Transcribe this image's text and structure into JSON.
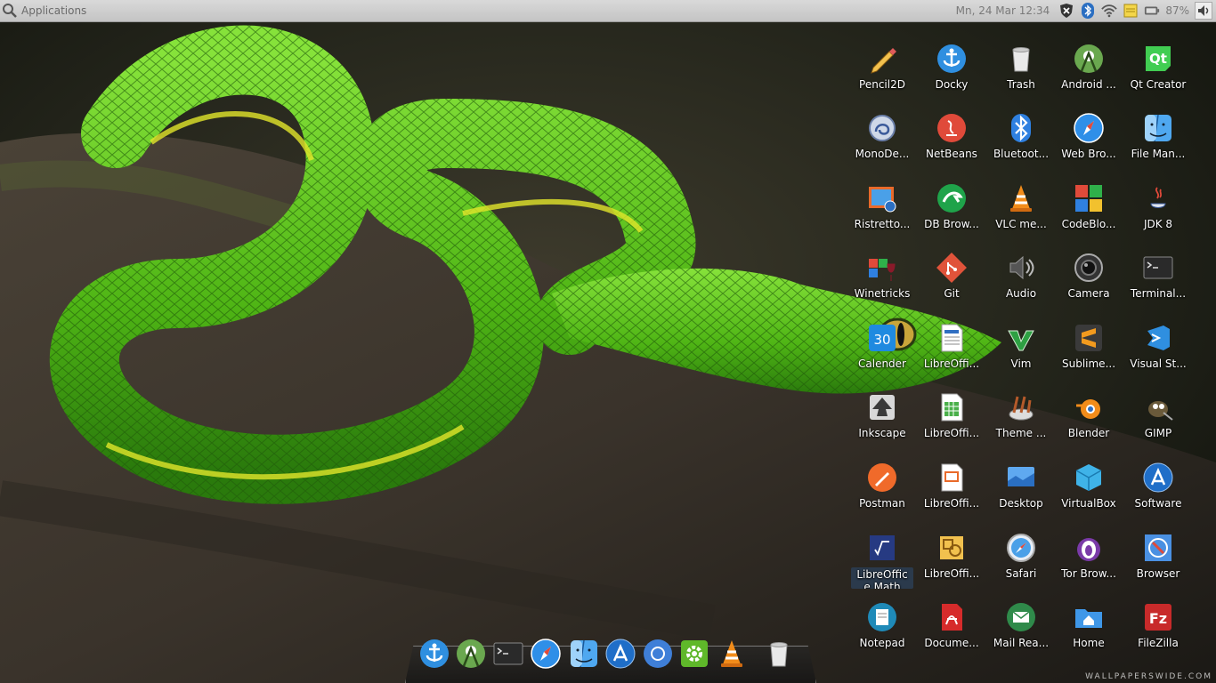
{
  "panel": {
    "apps_label": "Applications",
    "clock": "Mn, 24 Mar 12:34",
    "battery_pct": "87%"
  },
  "desktop": {
    "icons": [
      {
        "label": "Pencil2D",
        "icon": "pencil-icon"
      },
      {
        "label": "Docky",
        "icon": "anchor-icon"
      },
      {
        "label": "Trash",
        "icon": "trash-icon"
      },
      {
        "label": "Android ...",
        "icon": "android-studio-icon"
      },
      {
        "label": "Qt Creator",
        "icon": "qt-icon"
      },
      {
        "label": "MonoDe...",
        "icon": "monodevelop-icon"
      },
      {
        "label": "NetBeans",
        "icon": "netbeans-icon"
      },
      {
        "label": "Bluetoot...",
        "icon": "bluetooth-icon"
      },
      {
        "label": "Web Bro...",
        "icon": "compass-icon"
      },
      {
        "label": "File Man...",
        "icon": "finder-icon"
      },
      {
        "label": "Ristretto...",
        "icon": "image-viewer-icon"
      },
      {
        "label": "DB Brow...",
        "icon": "db-browser-icon"
      },
      {
        "label": "VLC me...",
        "icon": "vlc-cone-icon"
      },
      {
        "label": "CodeBlo...",
        "icon": "codeblocks-icon"
      },
      {
        "label": "JDK 8",
        "icon": "java-icon"
      },
      {
        "label": "Winetricks",
        "icon": "winetricks-icon"
      },
      {
        "label": "Git",
        "icon": "git-icon"
      },
      {
        "label": "Audio",
        "icon": "speaker-icon"
      },
      {
        "label": "Camera",
        "icon": "camera-icon"
      },
      {
        "label": "Terminal...",
        "icon": "terminal-icon"
      },
      {
        "label": "Calender",
        "icon": "calendar-icon",
        "badge": "30"
      },
      {
        "label": "LibreOffi...",
        "icon": "writer-doc-icon"
      },
      {
        "label": "Vim",
        "icon": "vim-icon"
      },
      {
        "label": "Sublime...",
        "icon": "sublime-icon"
      },
      {
        "label": "Visual St...",
        "icon": "vscode-icon"
      },
      {
        "label": "Inkscape",
        "icon": "inkscape-icon"
      },
      {
        "label": "LibreOffi...",
        "icon": "calc-sheet-icon"
      },
      {
        "label": "Theme ...",
        "icon": "theme-tools-icon"
      },
      {
        "label": "Blender",
        "icon": "blender-icon"
      },
      {
        "label": "GIMP",
        "icon": "gimp-icon"
      },
      {
        "label": "Postman",
        "icon": "postman-icon"
      },
      {
        "label": "LibreOffi...",
        "icon": "impress-icon"
      },
      {
        "label": "Desktop",
        "icon": "desktop-folder-icon"
      },
      {
        "label": "VirtualBox",
        "icon": "virtualbox-icon"
      },
      {
        "label": "Software",
        "icon": "app-store-icon"
      },
      {
        "label": "LibreOffic e Math",
        "icon": "math-formula-icon"
      },
      {
        "label": "LibreOffi...",
        "icon": "draw-icon"
      },
      {
        "label": "Safari",
        "icon": "safari-icon"
      },
      {
        "label": "Tor Brow...",
        "icon": "tor-onion-icon"
      },
      {
        "label": "Browser",
        "icon": "browser-globe-icon"
      },
      {
        "label": "Notepad",
        "icon": "notepad-icon"
      },
      {
        "label": "Docume...",
        "icon": "pdf-icon"
      },
      {
        "label": "Mail Rea...",
        "icon": "mail-icon"
      },
      {
        "label": "Home",
        "icon": "home-folder-icon"
      },
      {
        "label": "FileZilla",
        "icon": "filezilla-icon"
      }
    ]
  },
  "dock": {
    "items": [
      {
        "name": "docky",
        "icon": "anchor-icon"
      },
      {
        "name": "android-studio",
        "icon": "android-studio-icon"
      },
      {
        "name": "terminal",
        "icon": "terminal-icon"
      },
      {
        "name": "safari",
        "icon": "compass-icon"
      },
      {
        "name": "finder",
        "icon": "finder-icon"
      },
      {
        "name": "app-store",
        "icon": "app-store-icon"
      },
      {
        "name": "chromium",
        "icon": "chromium-icon"
      },
      {
        "name": "settings",
        "icon": "settings-icon"
      },
      {
        "name": "vlc",
        "icon": "vlc-cone-icon"
      },
      {
        "name": "trash",
        "icon": "trash-icon"
      }
    ]
  },
  "watermark": "WALLPAPERSWIDE.COM",
  "colors": {
    "panel_bg": "#cfcfcf",
    "label_text": "#ffffff",
    "snake_green": "#5fc41f",
    "selection_bg": "#2b3a4c"
  }
}
